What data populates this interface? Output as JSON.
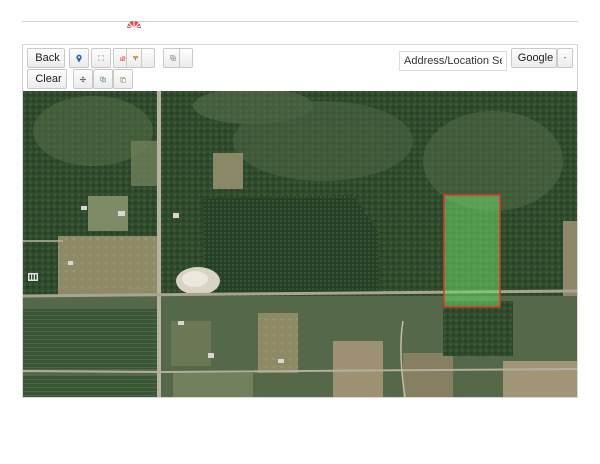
{
  "toolbar": {
    "back_label": "Back",
    "clear_label": "Clear",
    "search_placeholder": "Address/Location Search",
    "provider_label": "Google"
  },
  "icons": {
    "back": "arrow-left-icon",
    "pin": "map-pin-icon",
    "extent": "full-extent-icon",
    "identify": "identify-icon",
    "measure": "measure-icon",
    "layers": "layers-icon",
    "clear": "no-entry-icon",
    "pan": "pan-arrows-icon",
    "copy": "copy-icon",
    "paste": "paste-icon",
    "dropdown": "caret-down-icon"
  },
  "colors": {
    "parcel_outline": "#e8322a",
    "parcel_fill": "#6fd86a",
    "brand": "#d23a3a"
  }
}
